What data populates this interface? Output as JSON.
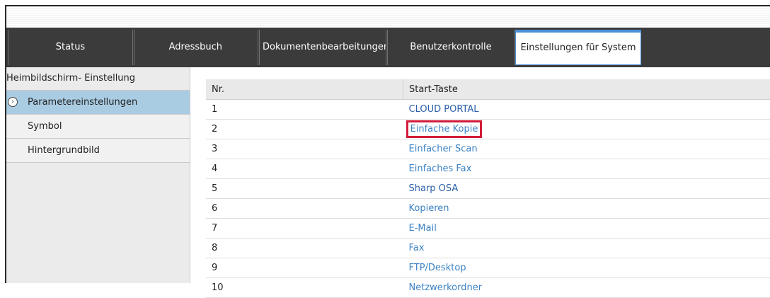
{
  "tabs": [
    {
      "label": "Status"
    },
    {
      "label": "Adressbuch"
    },
    {
      "label": "Dokumentenbearbeitungen"
    },
    {
      "label": "Benutzerkontrolle"
    },
    {
      "label": "Einstellungen für System"
    }
  ],
  "sidebar": {
    "header": "Heimbildschirm- Einstellung",
    "items": [
      {
        "label": "Parametereinstellungen",
        "icon": "chevron-right-circle-icon"
      },
      {
        "label": "Symbol"
      },
      {
        "label": "Hintergrundbild"
      }
    ]
  },
  "table": {
    "columns": [
      "Nr.",
      "Start-Taste"
    ],
    "rows": [
      {
        "nr": "1",
        "key": "CLOUD PORTAL"
      },
      {
        "nr": "2",
        "key": "Einfache Kopie"
      },
      {
        "nr": "3",
        "key": "Einfacher Scan"
      },
      {
        "nr": "4",
        "key": "Einfaches Fax"
      },
      {
        "nr": "5",
        "key": "Sharp OSA"
      },
      {
        "nr": "6",
        "key": "Kopieren"
      },
      {
        "nr": "7",
        "key": "E-Mail"
      },
      {
        "nr": "8",
        "key": "Fax"
      },
      {
        "nr": "9",
        "key": "FTP/Desktop"
      },
      {
        "nr": "10",
        "key": "Netzwerkordner"
      }
    ]
  },
  "colors": {
    "tab_bar": "#3b3b3b",
    "active_sidebar": "#a9cce3",
    "link": "#3b82c4",
    "highlight": "#d21c3a"
  }
}
